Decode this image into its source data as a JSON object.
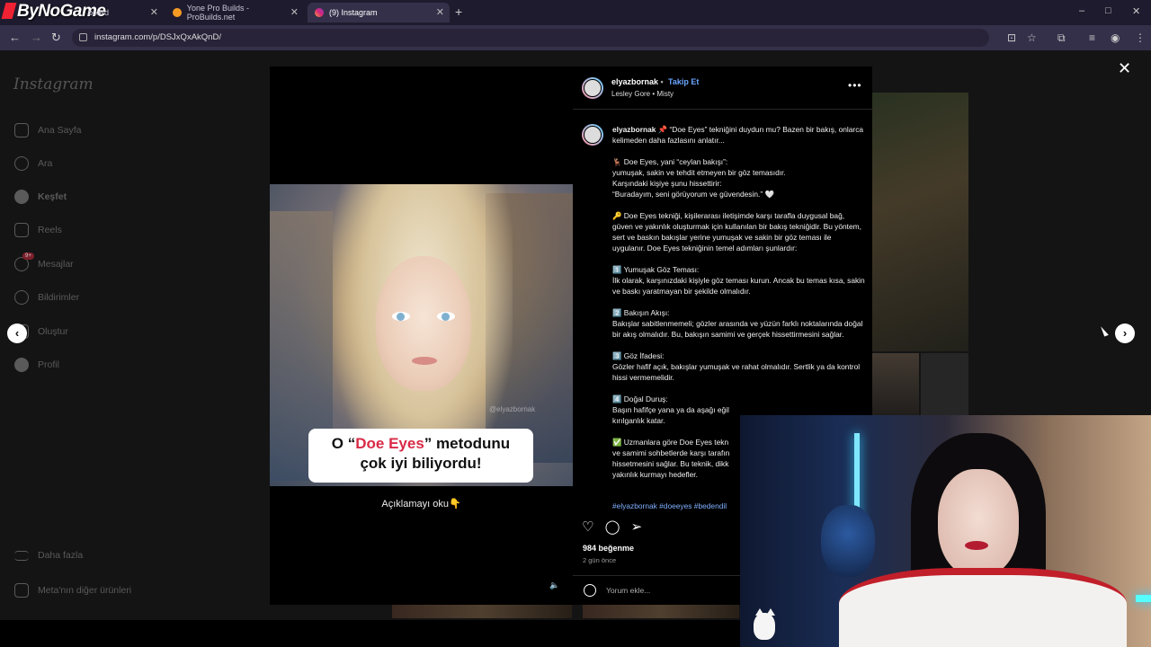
{
  "browser": {
    "brand": "ByNoGame",
    "tabs": [
      {
        "label": "board",
        "icon": "dashboard-icon"
      },
      {
        "label": "Yone Pro Builds - ProBuilds.net",
        "icon": "probuilds-icon"
      },
      {
        "label": "(9) Instagram",
        "icon": "instagram-icon"
      }
    ],
    "new_tab": "+",
    "url": "instagram.com/p/DSJxQxAkQnD/",
    "controls": {
      "minimize": "–",
      "maximize": "□",
      "close": "✕"
    }
  },
  "sidebar": {
    "logo": "Instagram",
    "items": [
      {
        "label": "Ana Sayfa",
        "icon": "home-icon"
      },
      {
        "label": "Ara",
        "icon": "search-icon"
      },
      {
        "label": "Keşfet",
        "icon": "compass-icon"
      },
      {
        "label": "Reels",
        "icon": "reels-icon"
      },
      {
        "label": "Mesajlar",
        "icon": "messages-icon",
        "badge": "9+"
      },
      {
        "label": "Bildirimler",
        "icon": "heart-icon"
      },
      {
        "label": "Oluştur",
        "icon": "plus-icon"
      },
      {
        "label": "Profil",
        "icon": "profile-icon"
      }
    ],
    "more": "Daha fazla",
    "meta": "Meta'nın diğer ürünleri"
  },
  "media": {
    "caption_prefix": "O “",
    "caption_highlight": "Doe Eyes",
    "caption_suffix": "” metodunu",
    "caption_line2": "çok iyi biliyordu!",
    "watermark": "@elyazbornak",
    "below_text": "Açıklamayı oku👇"
  },
  "post": {
    "username": "elyazbornak",
    "separator": "•",
    "follow": "Takip Et",
    "audio": "Lesley Gore • Misty",
    "more": "•••",
    "caption_user": "elyazbornak",
    "caption_intro": " 📌 “Doe Eyes” tekniğini duydun mu? Bazen bir bakış, onlarca kelimeden daha fazlasını anlatır...",
    "paragraphs": [
      "🦌 Doe Eyes, yani “ceylan bakışı”:\nyumuşak, sakin ve tehdit etmeyen bir göz temasıdır.\nKarşındaki kişiye şunu hissettirir:\n“Buradayım, seni görüyorum ve güvendesin.” 🤍",
      "🔑 Doe Eyes tekniği, kişilerarası iletişimde karşı tarafla duygusal bağ, güven ve yakınlık oluşturmak için kullanılan bir bakış tekniğidir. Bu yöntem, sert ve baskın bakışlar yerine yumuşak ve sakin bir göz teması ile uygulanır. Doe Eyes tekniğinin temel adımları şunlardır:",
      "1️⃣ Yumuşak Göz Teması:\nİlk olarak, karşınızdaki kişiyle göz teması kurun. Ancak bu temas kısa, sakin ve baskı yaratmayan bir şekilde olmalıdır.",
      "2️⃣ Bakışın Akışı:\nBakışlar sabitlenmemeli; gözler arasında ve yüzün farklı noktalarında doğal bir akış olmalıdır. Bu, bakışın samimi ve gerçek hissettirmesini sağlar.",
      "3️⃣ Göz İfadesi:\nGözler hafif açık, bakışlar yumuşak ve rahat olmalıdır. Sertlik ya da kontrol hissi vermemelidir.",
      "4️⃣ Doğal Duruş:\nBaşın hafifçe yana ya da aşağı eğil\nkırılganlık katar.",
      "✅ Uzmanlara göre Doe Eyes tekn\nve samimi sohbetlerde karşı tarafın\nhissetmesini sağlar. Bu teknik, dikk\nyakınlık kurmayı hedefler."
    ],
    "hashtags": "#elyazbornak #doeeyes #bedendil",
    "likes": "984 beğenme",
    "time": "2 gün önce",
    "comment_placeholder": "Yorum ekle..."
  },
  "nav": {
    "close": "✕",
    "prev": "‹",
    "next": "›"
  }
}
